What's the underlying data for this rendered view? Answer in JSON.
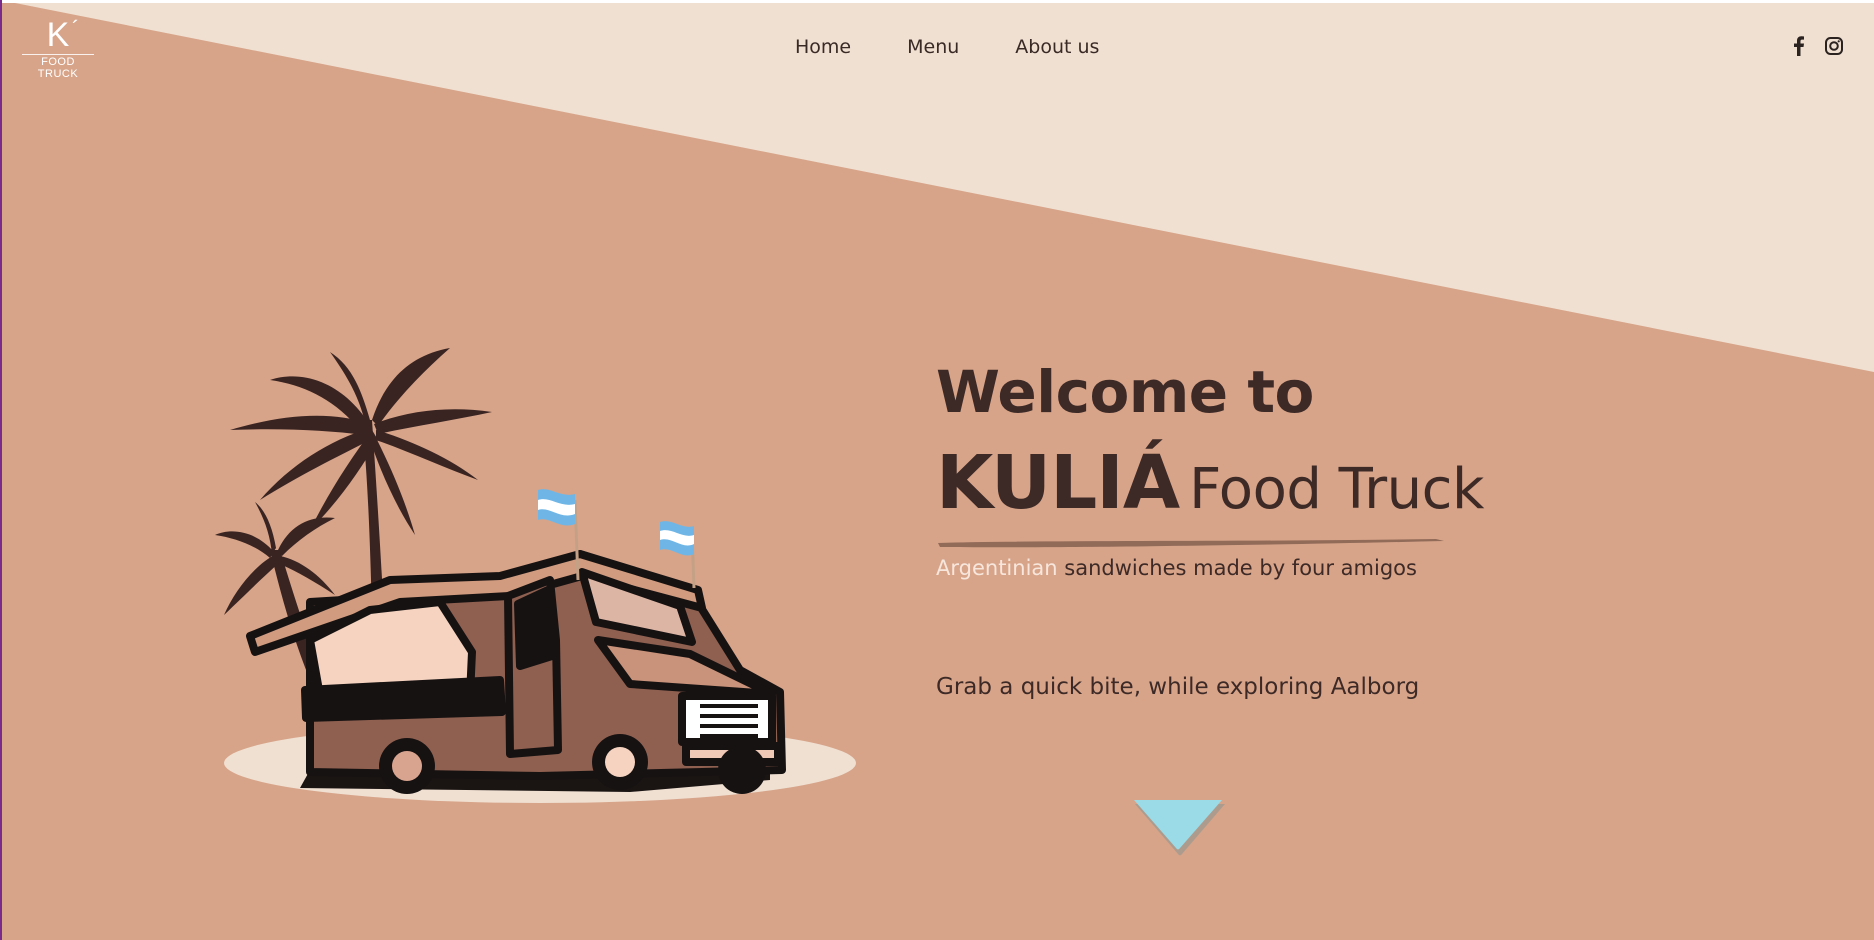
{
  "logo": {
    "mark": "K",
    "accent": "´",
    "subtitle": "FOOD TRUCK"
  },
  "nav": {
    "items": [
      "Home",
      "Menu",
      "About us"
    ]
  },
  "social": {
    "icons": [
      "facebook-icon",
      "instagram-icon"
    ]
  },
  "hero": {
    "welcome": "Welcome to",
    "brand": "KULIÁ",
    "brand_rest": "Food Truck",
    "tagline_highlight": "Argentinian",
    "tagline_rest": " sandwiches made by four amigos",
    "subtitle": "Grab a quick bite, while exploring Aalborg"
  },
  "colors": {
    "background": "#d7a489",
    "top_band": "#f0e0d2",
    "text_dark": "#3d2a27",
    "highlight": "#f7e6dc",
    "arrow": "#9adbe7",
    "truck_body": "#8f6050",
    "palm": "#3a2422"
  },
  "scroll": {
    "icon": "chevron-down-icon"
  }
}
